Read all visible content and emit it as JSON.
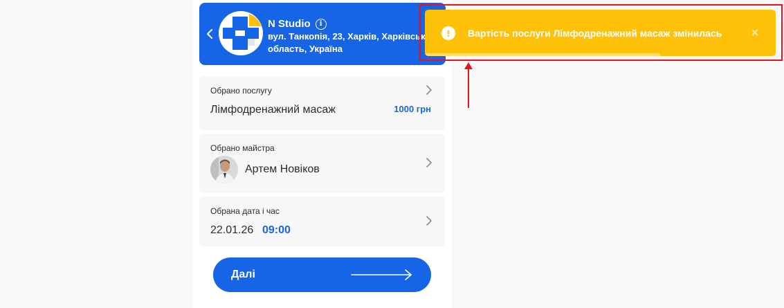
{
  "studio": {
    "name": "N Studio",
    "address": "вул. Танкопія, 23, Харків, Харківська область, Україна",
    "address_line1": "вул. Танкопія, 23, Харків, Харківськ",
    "address_line2": "область, Україна"
  },
  "service_card": {
    "label": "Обрано послугу",
    "service": "Лімфодренажний масаж",
    "price": "1000 грн"
  },
  "master_card": {
    "label": "Обрано майстра",
    "name": "Артем Новіков"
  },
  "datetime_card": {
    "label": "Обрана дата і час",
    "date": "22.01.26",
    "time": "09:00"
  },
  "next_button": {
    "label": "Далі"
  },
  "toast": {
    "message": "Вартість послуги Лімфодренажний масаж змінилась",
    "close": "×",
    "icon_glyph": "!",
    "progress": 0.67
  },
  "icons": [
    "chevron-left-icon",
    "info-icon",
    "chevron-right-icon",
    "arrow-right-icon",
    "warning-icon",
    "close-icon"
  ],
  "colors": {
    "primary": "#1565e6",
    "toast_warning": "#ffc107",
    "annotation": "#e8131d"
  }
}
